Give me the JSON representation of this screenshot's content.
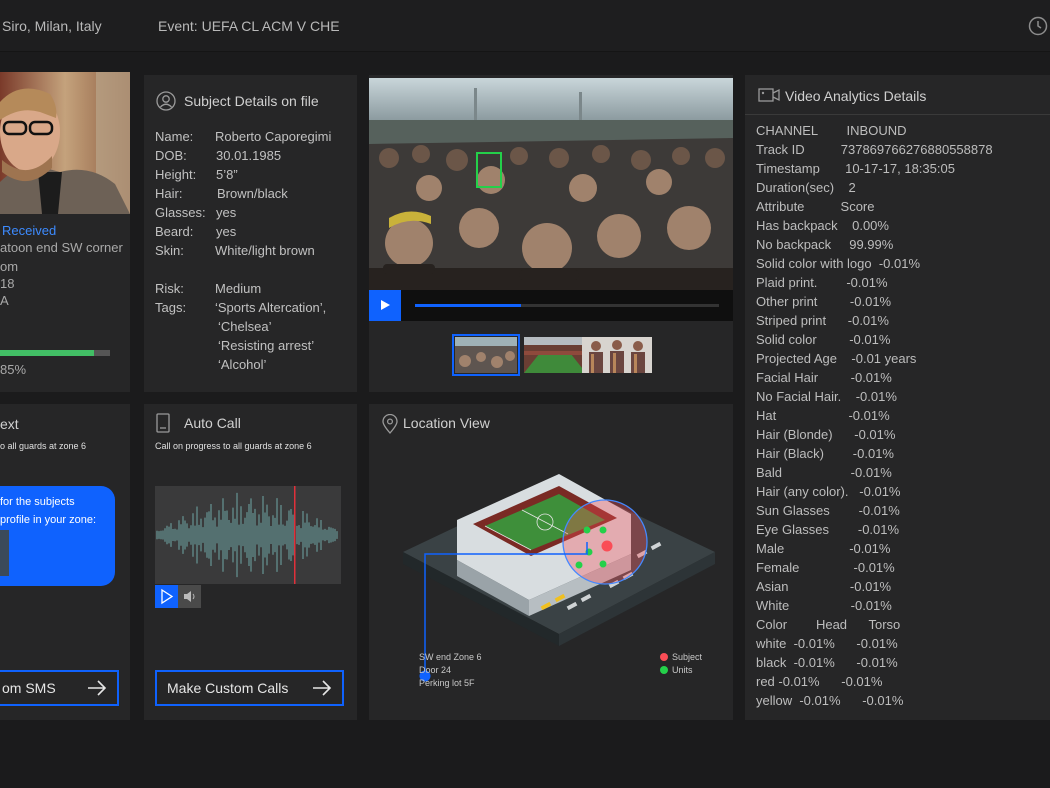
{
  "header": {
    "location": "Siro, Milan, Italy",
    "event": "Event: UEFA CL ACM V CHE",
    "clock_icon": "clock-icon"
  },
  "profile": {
    "alert": "Received",
    "lines": [
      "atoon end SW corner",
      "om",
      "18",
      "A"
    ],
    "progress": 0.85,
    "progress_label": "85%",
    "colors": {
      "alert": "#3d8bff",
      "progress": "#42be65"
    }
  },
  "subject": {
    "title": "Subject Details on file",
    "fields": [
      {
        "label": "Name:",
        "value": "Roberto Caporegimi"
      },
      {
        "label": "DOB:",
        "value": "30.01.1985"
      },
      {
        "label": "Height:",
        "value": "5’8”"
      },
      {
        "label": "Hair:",
        "value": "Brown/black"
      },
      {
        "label": "Glasses:",
        "value": "yes"
      },
      {
        "label": "Beard:",
        "value": "yes"
      },
      {
        "label": "Skin:",
        "value": "White/light brown"
      }
    ],
    "risk_label": "Risk:",
    "risk_value": "Medium",
    "tags_label": "Tags:",
    "tags": [
      "‘Sports Altercation’,",
      "‘Chelsea’",
      "‘Resisting arrest’",
      "‘Alcohol’"
    ]
  },
  "video": {
    "progress": 0.35,
    "thumbnails": [
      "crowd",
      "stadium",
      "three-people"
    ],
    "active_thumbnail": 0
  },
  "analytics": {
    "title": "Video Analytics Details",
    "lines": [
      "CHANNEL        INBOUND",
      "Track ID          737869766276880558878",
      "Timestamp       10-17-17, 18:35:05",
      "Duration(sec)    2",
      "Attribute          Score",
      "Has backpack    0.00%",
      "No backpack     99.99%",
      "Solid color with logo  -0.01%",
      "Plaid print.        -0.01%",
      "Other print         -0.01%",
      "Striped print      -0.01%",
      "Solid color         -0.01%",
      "Projected Age    -0.01 years",
      "Facial Hair         -0.01%",
      "No Facial Hair.    -0.01%",
      "Hat                    -0.01%",
      "Hair (Blonde)      -0.01%",
      "Hair (Black)        -0.01%",
      "Bald                   -0.01%",
      "Hair (any color).   -0.01%",
      "Sun Glasses        -0.01%",
      "Eye Glasses        -0.01%",
      "Male                  -0.01%",
      "Female               -0.01%",
      "Asian                 -0.01%",
      "White                 -0.01%",
      "Color        Head      Torso",
      "white  -0.01%      -0.01%",
      "black  -0.01%      -0.01%",
      "red -0.01%      -0.01%",
      "yellow  -0.01%      -0.01%"
    ]
  },
  "text_card": {
    "title": "ext",
    "status": "o all guards at zone 6",
    "bubble_lines": [
      "for the subjects",
      "profile in your zone:"
    ],
    "button": "om SMS"
  },
  "auto_call": {
    "title": "Auto Call",
    "status": "Call on progress to all guards at zone 6",
    "button": "Make Custom Calls"
  },
  "location": {
    "title": "Location View",
    "address": [
      "SW end Zone 6",
      "Door 24",
      "Perking lot 5F"
    ],
    "legend": [
      {
        "label": "Subject",
        "color": "#fa4d56"
      },
      {
        "label": "Units",
        "color": "#24d04a"
      }
    ]
  },
  "colors": {
    "accent": "#0f62fe",
    "card": "#262627",
    "bg": "#1b1b1c"
  }
}
